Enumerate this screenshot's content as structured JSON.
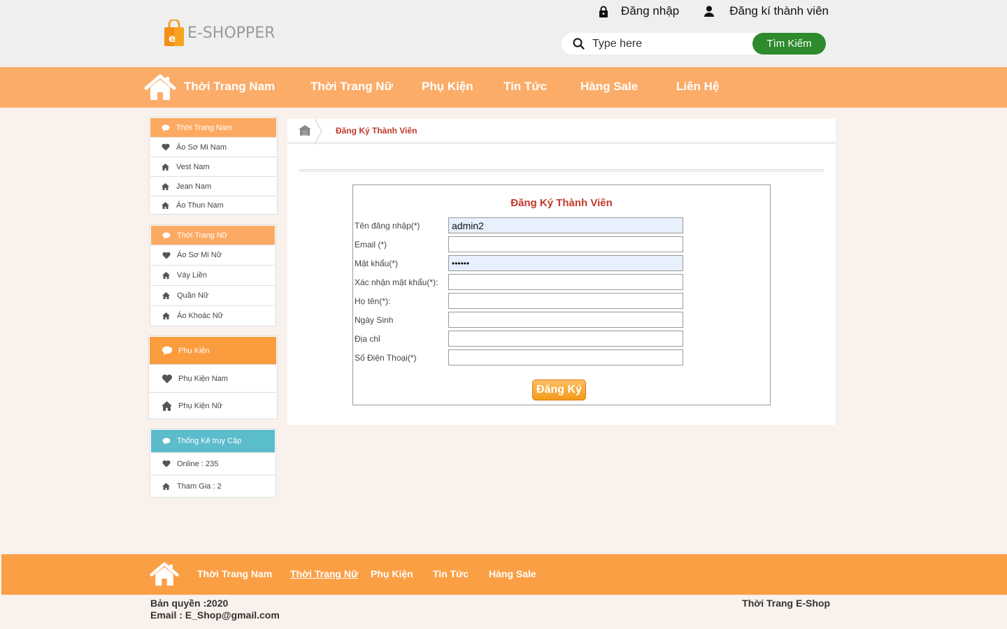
{
  "header": {
    "logo_text": "E-SHOPPER",
    "logo_badge": "e",
    "login_label": "Đăng nhập",
    "register_label": "Đăng kí thành viên",
    "search": {
      "placeholder": "Type here",
      "button_label": "Tìm Kiếm"
    }
  },
  "main_nav": {
    "items": [
      {
        "label": "Thời Trang Nam"
      },
      {
        "label": "Thời Trang Nữ"
      },
      {
        "label": "Phụ Kiện"
      },
      {
        "label": "Tin Tức"
      },
      {
        "label": "Hàng Sale"
      },
      {
        "label": "Liên  Hệ"
      }
    ]
  },
  "sidebar": {
    "men": {
      "title": "Thời Trang Nam",
      "items": [
        {
          "icon": "heart-icon",
          "label": "Áo Sơ Mi Nam"
        },
        {
          "icon": "home-icon",
          "label": "Vest Nam"
        },
        {
          "icon": "home-icon",
          "label": "Jean Nam"
        },
        {
          "icon": "home-icon",
          "label": "Áo Thun Nam"
        }
      ]
    },
    "women": {
      "title": "Thời Trang Nữ",
      "items": [
        {
          "icon": "heart-icon",
          "label": "Áo Sơ Mi Nữ"
        },
        {
          "icon": "home-icon",
          "label": "Váy Liền"
        },
        {
          "icon": "home-icon",
          "label": "Quần Nữ"
        },
        {
          "icon": "home-icon",
          "label": "Áo Khoác Nữ"
        }
      ]
    },
    "accessories": {
      "title": "Phụ Kiện",
      "items": [
        {
          "icon": "heart-icon",
          "label": "Phụ Kiện Nam"
        },
        {
          "icon": "home-icon",
          "label": "Phụ Kiện Nữ"
        }
      ]
    },
    "stats": {
      "title": "Thống Kê truy Cập",
      "items": [
        {
          "icon": "heart-icon",
          "label": "Online : 235"
        },
        {
          "icon": "home-icon",
          "label": "Tham Gia : 2"
        }
      ]
    }
  },
  "breadcrumb": {
    "current": "Đăng Ký Thành Viên"
  },
  "form": {
    "title": "Đăng Ký Thành Viên",
    "fields": [
      {
        "label": "Tên đăng nhập(*)",
        "value": "admin2",
        "type": "text"
      },
      {
        "label": "Email (*)",
        "value": "",
        "type": "text"
      },
      {
        "label": "Mật khẩu(*)",
        "value": "••••••",
        "type": "text"
      },
      {
        "label": "Xác nhận mật khẩu(*):",
        "value": "",
        "type": "text"
      },
      {
        "label": "Họ tên(*):",
        "value": "",
        "type": "text"
      },
      {
        "label": "Ngày Sinh",
        "value": "",
        "type": "text"
      },
      {
        "label": "Địa chỉ",
        "value": "",
        "type": "text"
      },
      {
        "label": "Số Điện Thoại(*)",
        "value": "",
        "type": "text"
      }
    ],
    "submit_label": "Đăng Ký"
  },
  "footer": {
    "nav": [
      {
        "label": "Thời Trang Nam"
      },
      {
        "label": "Thời Trang Nữ"
      },
      {
        "label": "Phụ Kiện"
      },
      {
        "label": "Tin Tức"
      },
      {
        "label": "Hàng Sale"
      }
    ],
    "copyright": "Bản quyền :2020",
    "email": "Email : E_Shop@gmail.com",
    "brand": "Thời Trang E-Shop"
  },
  "colors": {
    "nav_bg": "#fbac68",
    "footer_bg": "#fb9f45",
    "search_button": "#2d8a2d",
    "accent_red": "#c0392b",
    "stats_header": "#5bbccb"
  }
}
